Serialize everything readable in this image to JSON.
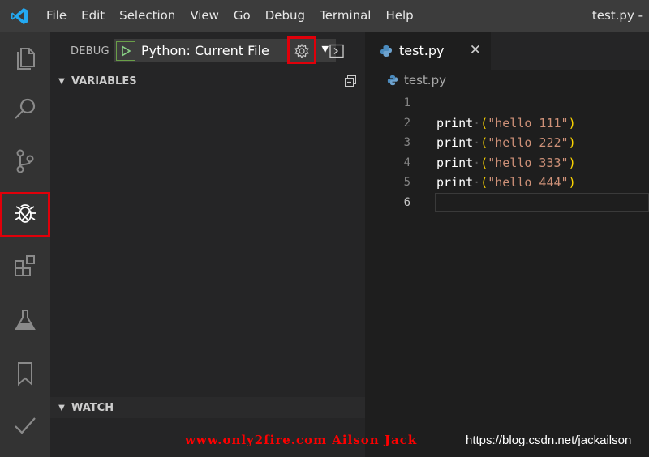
{
  "menu": {
    "items": [
      "File",
      "Edit",
      "Selection",
      "View",
      "Go",
      "Debug",
      "Terminal",
      "Help"
    ]
  },
  "window": {
    "title": "test.py -"
  },
  "activity_bar": {
    "icons": [
      "explorer-icon",
      "search-icon",
      "source-control-icon",
      "debug-icon",
      "extensions-icon",
      "test-flask-icon",
      "bookmark-icon",
      "check-icon"
    ],
    "active": "debug-icon"
  },
  "debug": {
    "label": "DEBUG",
    "configuration": "Python: Current File"
  },
  "sections": {
    "variables": "VARIABLES",
    "watch": "WATCH"
  },
  "editor": {
    "tab_label": "test.py",
    "breadcrumb": "test.py",
    "lines": [
      {
        "number": "1",
        "func": "",
        "string": ""
      },
      {
        "number": "2",
        "func": "print",
        "string": "\"hello 111\""
      },
      {
        "number": "3",
        "func": "print",
        "string": "\"hello 222\""
      },
      {
        "number": "4",
        "func": "print",
        "string": "\"hello 333\""
      },
      {
        "number": "5",
        "func": "print",
        "string": "\"hello 444\""
      },
      {
        "number": "6",
        "func": "",
        "string": ""
      }
    ]
  },
  "watermark": {
    "site": "www.only2fire.com Ailson Jack",
    "url": "https://blog.csdn.net/jackailson"
  },
  "colors": {
    "highlight": "#e0000a",
    "string": "#ce9178",
    "paren": "#ffd700",
    "play": "#89d185"
  }
}
